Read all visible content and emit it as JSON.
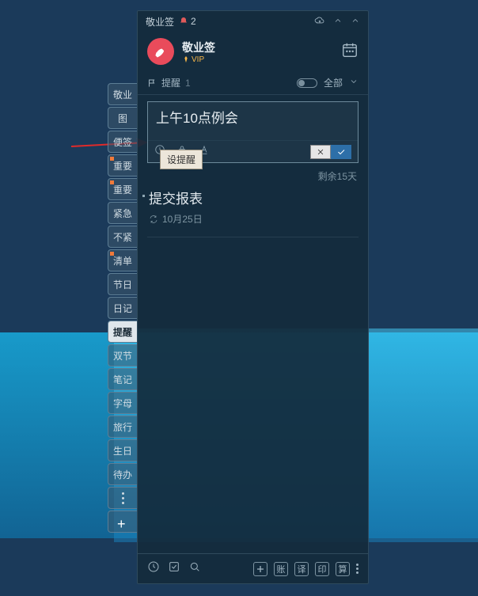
{
  "titlebar": {
    "app_name": "敬业签",
    "notification_count": "2"
  },
  "header": {
    "app_name": "敬业签",
    "vip_label": "VIP"
  },
  "section": {
    "title": "提醒",
    "count": "1",
    "filter_label": "全部"
  },
  "editor": {
    "input_value": "上午10点例会",
    "tooltip": "设提醒"
  },
  "remaining_text": "剩余15天",
  "items": [
    {
      "title": "提交报表",
      "date": "10月25日"
    }
  ],
  "side_tabs": [
    "敬业",
    "图",
    "便签",
    "重要",
    "重要",
    "紧急",
    "不紧",
    "清单",
    "节日",
    "日记",
    "提醒",
    "双节",
    "笔记",
    "字母",
    "旅行",
    "生日",
    "待办"
  ],
  "active_tab_index": 10,
  "accent_tab_indices": [
    3,
    4,
    7
  ],
  "bottom_chips": [
    "账",
    "译",
    "印",
    "算"
  ]
}
